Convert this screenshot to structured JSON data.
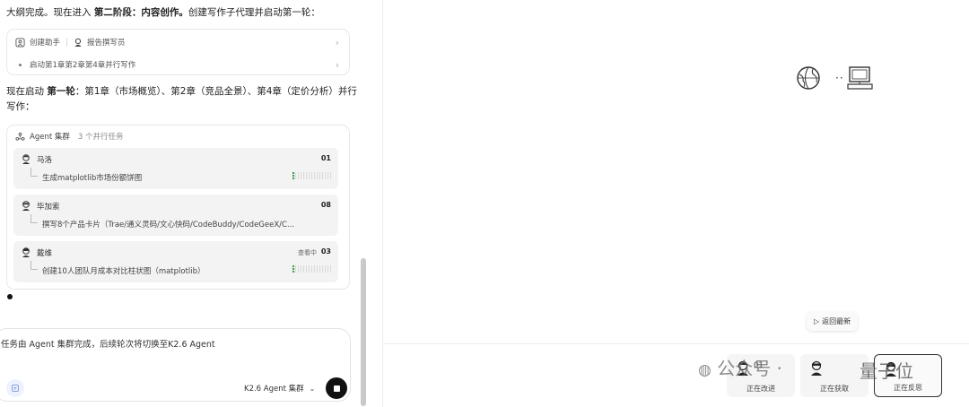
{
  "chat": {
    "intro": {
      "prefix": "大纲完成。现在进入 ",
      "stage_strong": "第二阶段：内容创作。",
      "suffix": "创建写作子代理并启动第一轮："
    },
    "create_card": {
      "row1_label": "创建助手",
      "row1_agent": "报告撰写员",
      "row2_label": "启动第1章第2章第4章并行写作"
    },
    "round_text": {
      "prefix": "现在启动 ",
      "round_strong": "第一轮",
      "suffix": "：第1章（市场概览）、第2章（竞品全景）、第4章（定价分析）并行",
      "line2": "写作："
    },
    "cluster": {
      "title": "Agent 集群",
      "count": "3 个并行任务",
      "agents": [
        {
          "name": "马洛",
          "number": "01",
          "status": "",
          "task": "生成matplotlib市场份额饼图"
        },
        {
          "name": "毕加索",
          "number": "08",
          "status": "",
          "task": "撰写8个产品卡片（Trae/通义灵码/文心快码/CodeBuddy/CodeGeeX/C..."
        },
        {
          "name": "戴维",
          "number": "03",
          "status": "查看中",
          "task": "创建10人团队月成本对比柱状图（matplotlib）"
        }
      ]
    },
    "composer": {
      "text": "任务由 Agent 集群完成，后续轮次将切换至K2.6 Agent",
      "model": "K2.6 Agent 集群"
    }
  },
  "canvas": {
    "back_latest": "返回最新",
    "agents": [
      {
        "number": "01",
        "status": "正在改进"
      },
      {
        "number": "",
        "status": "正在获取"
      },
      {
        "number": "",
        "status": "正在反思"
      }
    ],
    "watermark_left": "公众号 · ",
    "watermark_right": "量子位"
  }
}
